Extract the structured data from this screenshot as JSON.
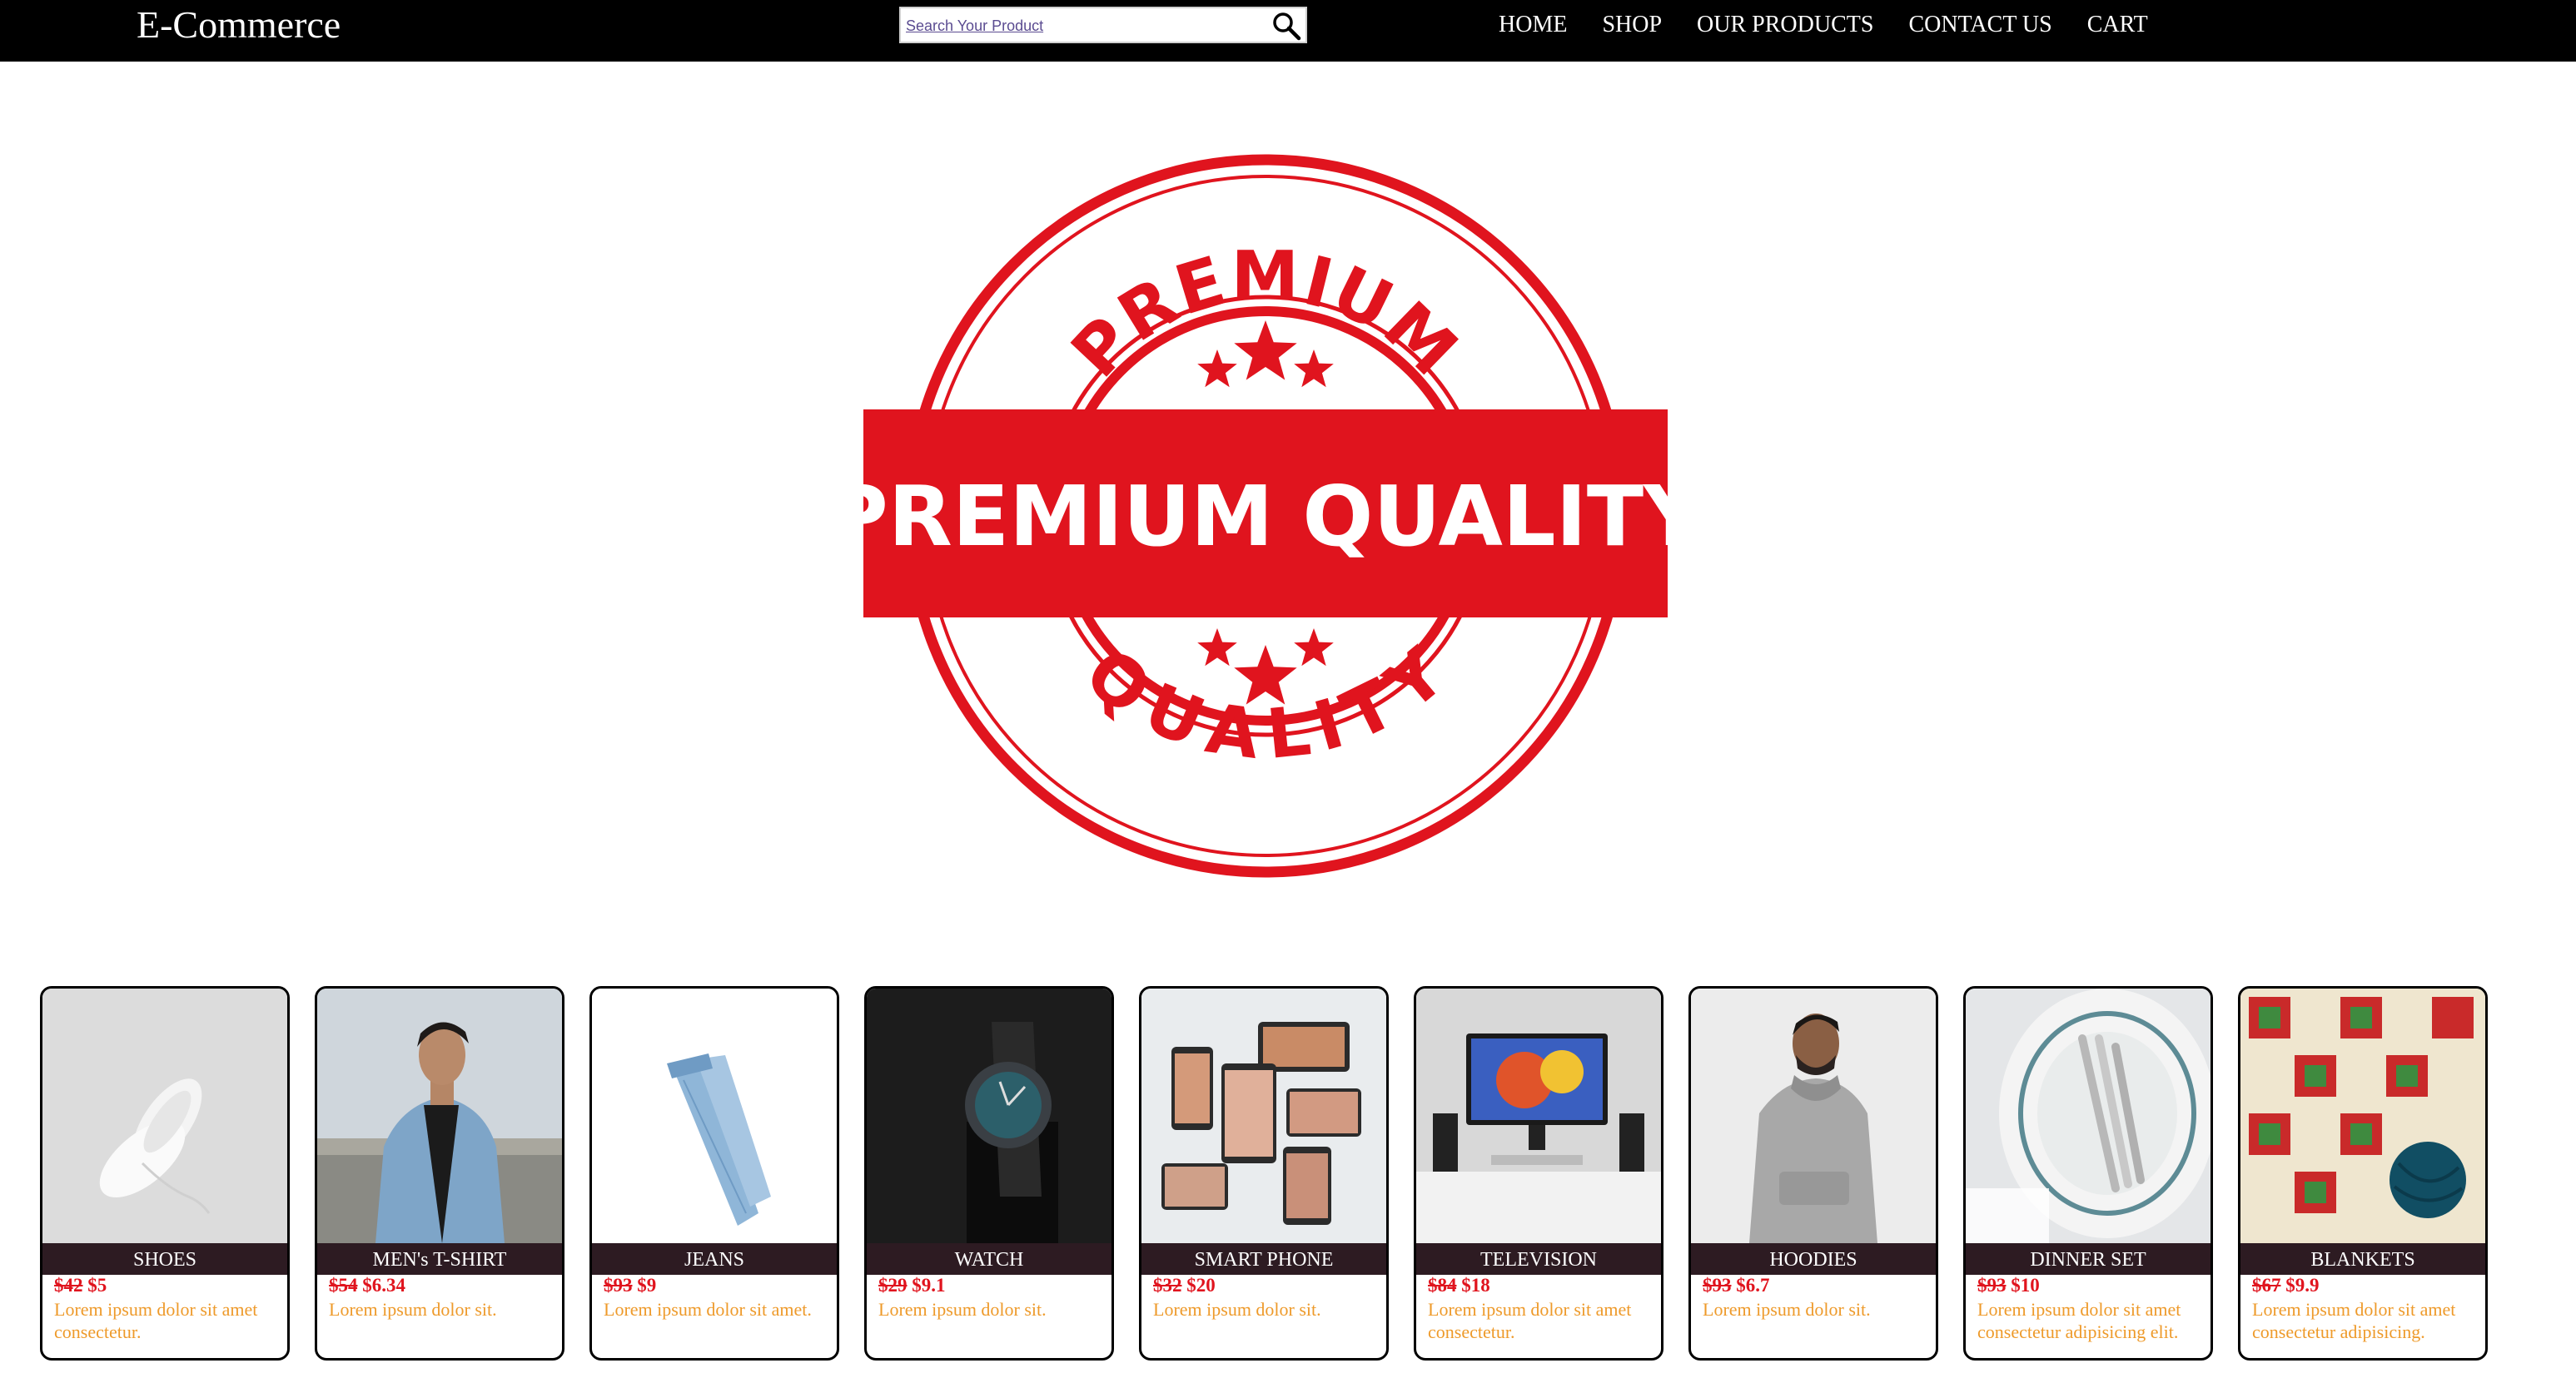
{
  "navbar": {
    "brand": "E-Commerce",
    "search_placeholder": "Search Your Product",
    "links": [
      "HOME",
      "SHOP",
      "OUR PRODUCTS",
      "CONTACT US",
      "CART"
    ]
  },
  "hero": {
    "stamp_top": "PREMIUM",
    "stamp_banner": "PREMIUM QUALITY",
    "stamp_bottom": "QUALITY"
  },
  "colors": {
    "navbar_bg": "#000000",
    "stamp_red": "#e0141e",
    "product_label_bg": "#2d1b22",
    "new_price": "#e0141e",
    "description": "#ee9a2a"
  },
  "products": [
    {
      "name": "SHOES",
      "old_price": "$42",
      "new_price": "$5",
      "description": "Lorem ipsum dolor sit amet consectetur.",
      "image": "white-sneakers"
    },
    {
      "name": "MEN's T-SHIRT",
      "old_price": "$54",
      "new_price": "$6.34",
      "description": "Lorem ipsum dolor sit.",
      "image": "man-denim-jacket"
    },
    {
      "name": "JEANS",
      "old_price": "$93",
      "new_price": "$9",
      "description": "Lorem ipsum dolor sit amet.",
      "image": "blue-jeans"
    },
    {
      "name": "WATCH",
      "old_price": "$29",
      "new_price": "$9.1",
      "description": "Lorem ipsum dolor sit.",
      "image": "wrist-watch"
    },
    {
      "name": "SMART PHONE",
      "old_price": "$32",
      "new_price": "$20",
      "description": "Lorem ipsum dolor sit.",
      "image": "smart-phones"
    },
    {
      "name": "TELEVISION",
      "old_price": "$84",
      "new_price": "$18",
      "description": "Lorem ipsum dolor sit amet consectetur.",
      "image": "desk-monitor"
    },
    {
      "name": "HOODIES",
      "old_price": "$93",
      "new_price": "$6.7",
      "description": "Lorem ipsum dolor sit.",
      "image": "grey-hoodie"
    },
    {
      "name": "DINNER SET",
      "old_price": "$93",
      "new_price": "$10",
      "description": "Lorem ipsum dolor sit amet consectetur adipisicing elit.",
      "image": "plates-spoons"
    },
    {
      "name": "BLANKETS",
      "old_price": "$67",
      "new_price": "$9.9",
      "description": "Lorem ipsum dolor sit amet consectetur adipisicing.",
      "image": "crochet-blanket"
    }
  ]
}
